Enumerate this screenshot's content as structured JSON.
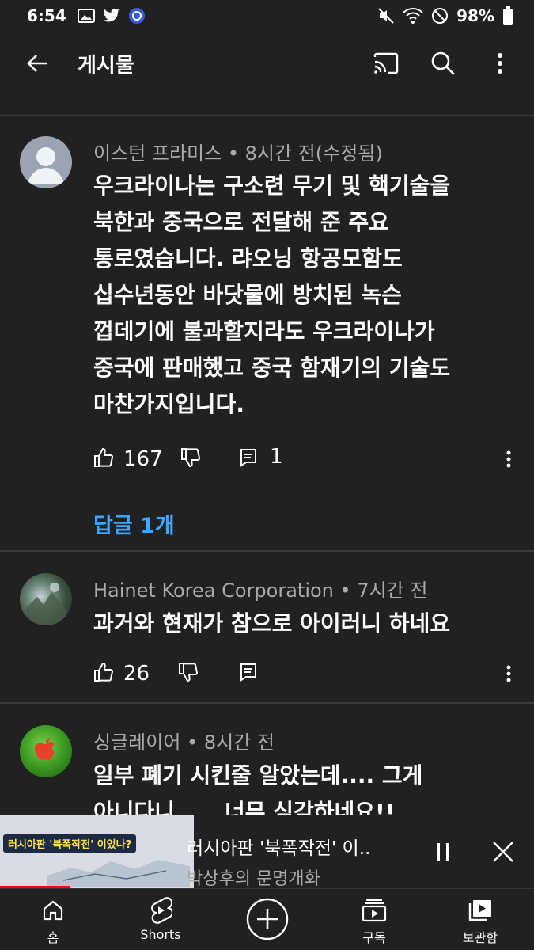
{
  "status_bar": {
    "time": "6:54",
    "battery": "98%"
  },
  "app_bar": {
    "title": "게시물"
  },
  "comments": [
    {
      "author": "이스턴 프라미스",
      "time": "8시간 전(수정됨)",
      "lines": [
        "우크라이나는 구소련 무기 및 핵기술을",
        "북한과 중국으로 전달해 준 주요",
        "통로였습니다. 랴오닝 항공모함도",
        "십수년동안 바닷물에 방치된 녹슨",
        "껍데기에 불과할지라도 우크라이나가",
        "중국에 판매했고 중국 함재기의 기술도",
        "마찬가지입니다."
      ],
      "likes": "167",
      "reply_count": "1",
      "replies_link": "답글 1개"
    },
    {
      "author": "Hainet Korea Corporation",
      "time": "7시간 전",
      "lines": [
        "과거와 현재가 참으로 아이러니 하네요"
      ],
      "likes": "26"
    },
    {
      "author": "싱글레이어",
      "time": "8시간 전",
      "lines": [
        "일부 폐기 시킨줄 알았는데.... 그게",
        "아니다니..... 너무 심각하네요!!"
      ]
    }
  ],
  "mini_player": {
    "title": "러시아판 '북폭작전' 이..",
    "channel": "박상후의 문명개화",
    "thumbnail_banner": "러시아판 '북폭작전' 이었나?",
    "progress": 0.36
  },
  "bottom_nav": [
    {
      "label": "홈",
      "icon": "home-icon"
    },
    {
      "label": "Shorts",
      "icon": "shorts-icon"
    },
    {
      "label": "",
      "icon": "create-icon"
    },
    {
      "label": "구독",
      "icon": "subscriptions-icon"
    },
    {
      "label": "보관함",
      "icon": "library-icon"
    }
  ]
}
